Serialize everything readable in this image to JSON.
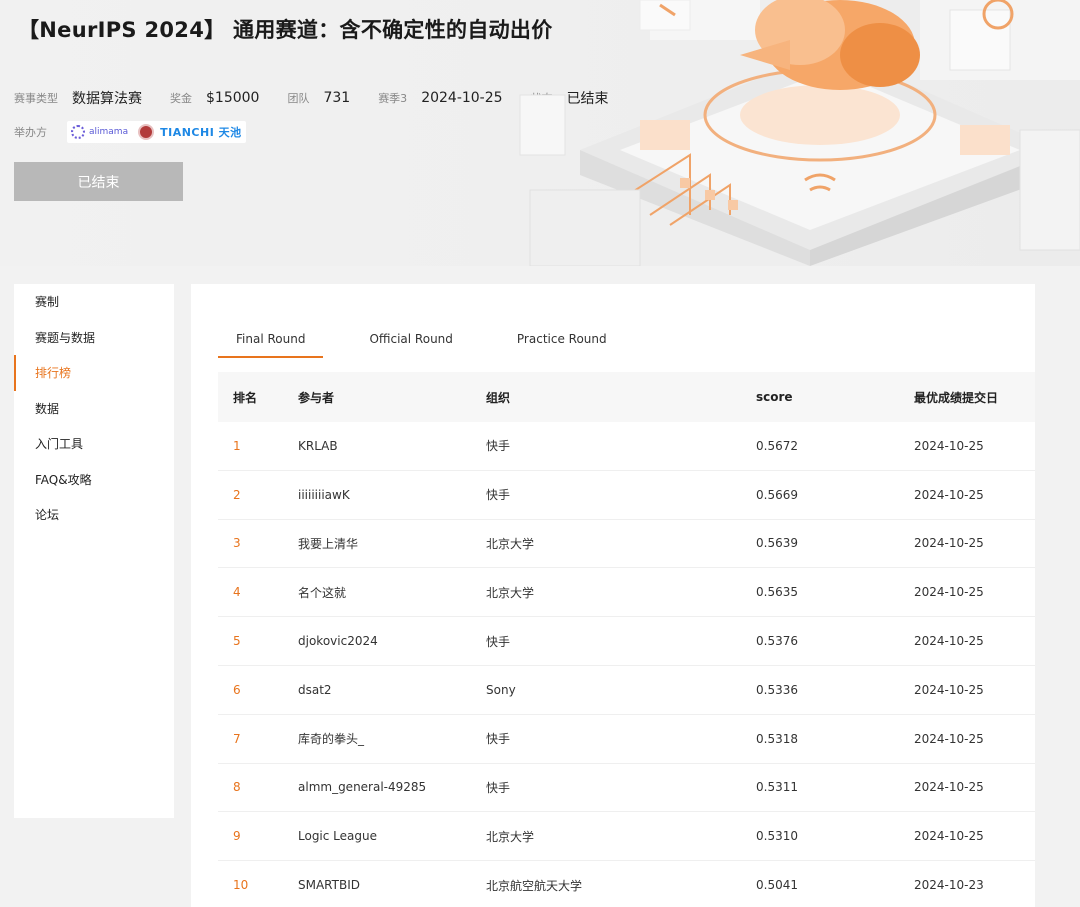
{
  "header": {
    "title": "【NeurIPS 2024】 通用赛道：含不确定性的自动出价",
    "meta": [
      {
        "key": "赛事类型",
        "value": "数据算法赛"
      },
      {
        "key": "奖金",
        "value": "$15000"
      },
      {
        "key": "团队",
        "value": "731"
      },
      {
        "key": "赛季3",
        "value": "2024-10-25"
      },
      {
        "key": "状态",
        "value": "已结束"
      }
    ],
    "host_label": "举办方",
    "host_logos": {
      "alimama": "alimama",
      "tianchi": "TIANCHI 天池"
    },
    "ended_button": "已结束"
  },
  "sidebar": {
    "items": [
      {
        "label": "赛制",
        "active": false
      },
      {
        "label": "赛题与数据",
        "active": false
      },
      {
        "label": "排行榜",
        "active": true
      },
      {
        "label": "数据",
        "active": false
      },
      {
        "label": "入门工具",
        "active": false
      },
      {
        "label": "FAQ&攻略",
        "active": false
      },
      {
        "label": "论坛",
        "active": false
      }
    ]
  },
  "tabs": [
    {
      "label": "Final Round",
      "active": true
    },
    {
      "label": "Official Round",
      "active": false
    },
    {
      "label": "Practice Round",
      "active": false
    }
  ],
  "table": {
    "columns": [
      "排名",
      "参与者",
      "组织",
      "score",
      "最优成绩提交日"
    ],
    "rows": [
      {
        "rank": "1",
        "participant": "KRLAB",
        "org": "快手",
        "score": "0.5672",
        "date": "2024-10-25"
      },
      {
        "rank": "2",
        "participant": "iiiiiiiiawK",
        "org": "快手",
        "score": "0.5669",
        "date": "2024-10-25"
      },
      {
        "rank": "3",
        "participant": "我要上清华",
        "org": "北京大学",
        "score": "0.5639",
        "date": "2024-10-25"
      },
      {
        "rank": "4",
        "participant": "名个这就",
        "org": "北京大学",
        "score": "0.5635",
        "date": "2024-10-25"
      },
      {
        "rank": "5",
        "participant": "djokovic2024",
        "org": "快手",
        "score": "0.5376",
        "date": "2024-10-25"
      },
      {
        "rank": "6",
        "participant": "dsat2",
        "org": "Sony",
        "score": "0.5336",
        "date": "2024-10-25"
      },
      {
        "rank": "7",
        "participant": "库奇的拳头_",
        "org": "快手",
        "score": "0.5318",
        "date": "2024-10-25"
      },
      {
        "rank": "8",
        "participant": "almm_general-49285",
        "org": "快手",
        "score": "0.5311",
        "date": "2024-10-25"
      },
      {
        "rank": "9",
        "participant": "Logic League",
        "org": "北京大学",
        "score": "0.5310",
        "date": "2024-10-25"
      },
      {
        "rank": "10",
        "participant": "SMARTBID",
        "org": "北京航空航天大学",
        "score": "0.5041",
        "date": "2024-10-23"
      }
    ]
  },
  "colors": {
    "accent": "#e8741d",
    "ended_button": "#b8b8b8"
  }
}
